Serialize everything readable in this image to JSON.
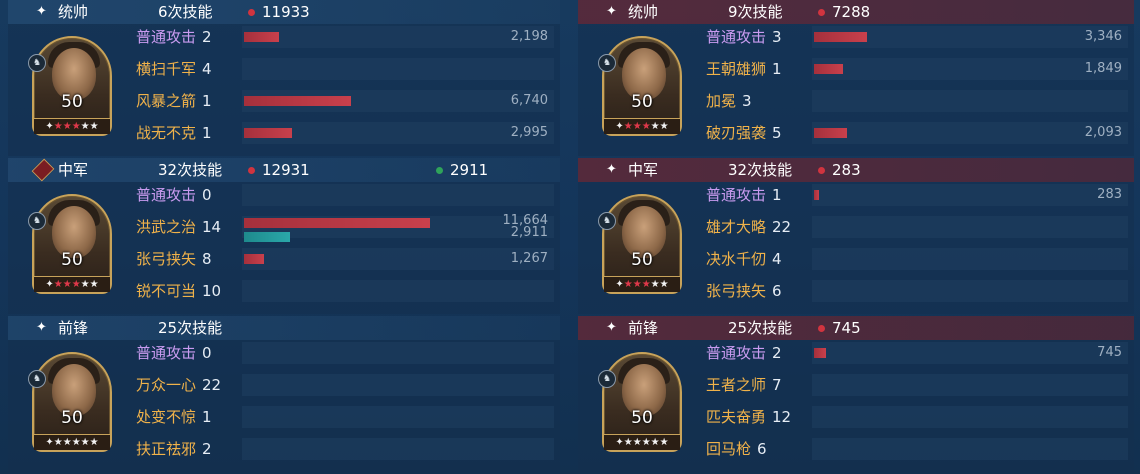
{
  "icons": {
    "role": "sparkle-icon",
    "banner": "banner-icon",
    "mount": "horse-icon"
  },
  "colors": {
    "damage": "#d0343f",
    "heal": "#2fa35a",
    "normal_attack": "#c99bf0",
    "skill": "#f0b24a"
  },
  "left": {
    "commander": {
      "role": "统帅",
      "casts": "6次技能",
      "damage": "11933",
      "level": "50",
      "stars": "★★★★★",
      "star_count": 5,
      "skills": [
        {
          "name": "普通攻击",
          "count": "2",
          "value": "2,198",
          "dmg": 2198
        },
        {
          "name": "横扫千军",
          "count": "4",
          "value": "",
          "dmg": 0
        },
        {
          "name": "风暴之箭",
          "count": "1",
          "value": "6,740",
          "dmg": 6740
        },
        {
          "name": "战无不克",
          "count": "1",
          "value": "2,995",
          "dmg": 2995
        }
      ]
    },
    "center": {
      "role": "中军",
      "casts": "32次技能",
      "damage": "12931",
      "heal": "2911",
      "level": "50",
      "stars": "★★★★★",
      "star_count": 5,
      "skills": [
        {
          "name": "普通攻击",
          "count": "0",
          "value": "",
          "dmg": 0
        },
        {
          "name": "洪武之治",
          "count": "14",
          "value": "11,664",
          "value2": "2,911",
          "dmg": 11664,
          "heal": 2911
        },
        {
          "name": "张弓挟矢",
          "count": "8",
          "value": "1,267",
          "dmg": 1267
        },
        {
          "name": "锐不可当",
          "count": "10",
          "value": "",
          "dmg": 0
        }
      ]
    },
    "vanguard": {
      "role": "前锋",
      "casts": "25次技能",
      "level": "50",
      "stars": "★★★★★",
      "star_count": 5,
      "skills": [
        {
          "name": "普通攻击",
          "count": "0",
          "value": "",
          "dmg": 0
        },
        {
          "name": "万众一心",
          "count": "22",
          "value": "",
          "dmg": 0
        },
        {
          "name": "处变不惊",
          "count": "1",
          "value": "",
          "dmg": 0
        },
        {
          "name": "扶正祛邪",
          "count": "2",
          "value": "",
          "dmg": 0
        }
      ]
    }
  },
  "right": {
    "commander": {
      "role": "统帅",
      "casts": "9次技能",
      "damage": "7288",
      "level": "50",
      "stars": "★★★★★",
      "star_count": 5,
      "skills": [
        {
          "name": "普通攻击",
          "count": "3",
          "value": "3,346",
          "dmg": 3346
        },
        {
          "name": "王朝雄狮",
          "count": "1",
          "value": "1,849",
          "dmg": 1849
        },
        {
          "name": "加冕",
          "count": "3",
          "value": "",
          "dmg": 0
        },
        {
          "name": "破刃强袭",
          "count": "5",
          "value": "2,093",
          "dmg": 2093
        }
      ]
    },
    "center": {
      "role": "中军",
      "casts": "32次技能",
      "damage": "283",
      "level": "50",
      "stars": "★★★★★",
      "star_count": 5,
      "skills": [
        {
          "name": "普通攻击",
          "count": "1",
          "value": "283",
          "dmg": 283
        },
        {
          "name": "雄才大略",
          "count": "22",
          "value": "",
          "dmg": 0
        },
        {
          "name": "决水千仞",
          "count": "4",
          "value": "",
          "dmg": 0
        },
        {
          "name": "张弓挟矢",
          "count": "6",
          "value": "",
          "dmg": 0
        }
      ]
    },
    "vanguard": {
      "role": "前锋",
      "casts": "25次技能",
      "damage": "745",
      "level": "50",
      "stars": "★★★★★",
      "star_count": 5,
      "skills": [
        {
          "name": "普通攻击",
          "count": "2",
          "value": "745",
          "dmg": 745
        },
        {
          "name": "王者之师",
          "count": "7",
          "value": "",
          "dmg": 0
        },
        {
          "name": "匹夫奋勇",
          "count": "12",
          "value": "",
          "dmg": 0
        },
        {
          "name": "回马枪",
          "count": "6",
          "value": "",
          "dmg": 0
        }
      ]
    }
  }
}
